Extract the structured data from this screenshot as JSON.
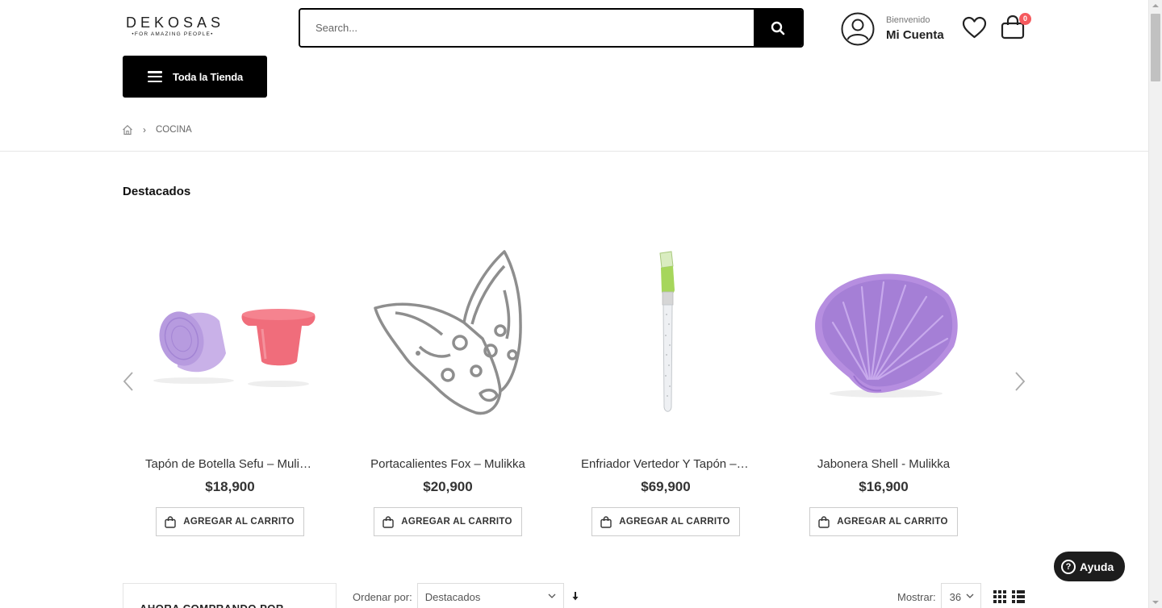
{
  "header": {
    "logo": {
      "main": "DEKOSAS",
      "sub": "•FOR AMAZING PEOPLE•"
    },
    "search": {
      "placeholder": "Search...",
      "icon": "search-icon"
    },
    "account": {
      "welcome": "Bienvenido",
      "name": "Mi Cuenta",
      "icon": "user-circle-icon"
    },
    "wishlist": {
      "icon": "heart-icon"
    },
    "cart": {
      "icon": "shopping-bag-icon",
      "count": "0"
    },
    "store_button": {
      "label": "Toda la Tienda",
      "icon": "menu-icon"
    }
  },
  "breadcrumb": {
    "home_icon": "home-icon",
    "items": [
      "COCINA"
    ]
  },
  "featured": {
    "title": "Destacados",
    "products": [
      {
        "name": "Tapón de Botella Sefu – Mulikka",
        "price": "$18,900",
        "button": "AGREGAR AL CARRITO"
      },
      {
        "name": "Portacalientes Fox – Mulikka",
        "price": "$20,900",
        "button": "AGREGAR AL CARRITO"
      },
      {
        "name": "Enfriador Vertedor Y Tapón – Mulikka",
        "price": "$69,900",
        "button": "AGREGAR AL CARRITO"
      },
      {
        "name": "Jabonera Shell - Mulikka",
        "price": "$16,900",
        "button": "AGREGAR AL CARRITO"
      }
    ]
  },
  "toolbar": {
    "sidebar_title": "AHORA COMPRANDO POR",
    "sort_label": "Ordenar por:",
    "sort_value": "Destacados",
    "show_label": "Mostrar:",
    "show_value": "36"
  },
  "help": {
    "label": "Ayuda"
  },
  "colors": {
    "accent": "#000000",
    "badge": "#f5595d",
    "product_purple": "#b68ee0",
    "product_pink": "#f06d7b",
    "product_green": "#a6d65b"
  }
}
